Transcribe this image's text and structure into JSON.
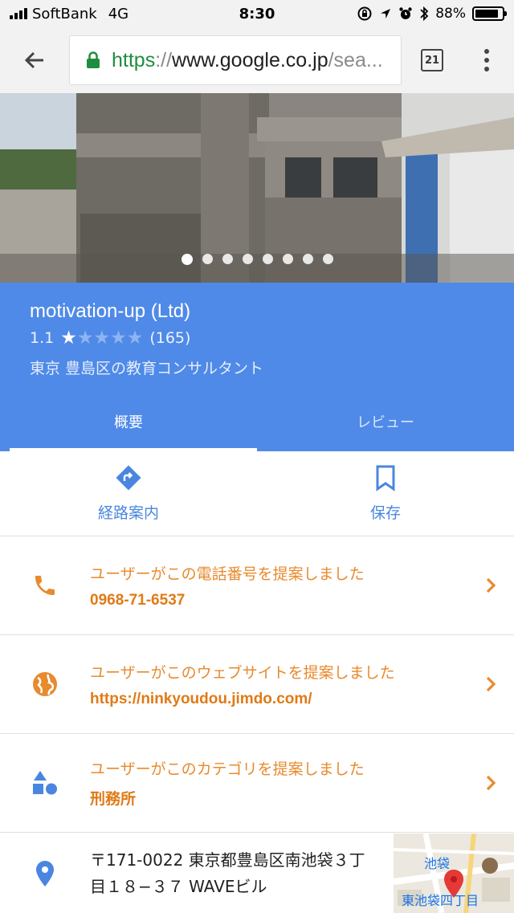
{
  "status_bar": {
    "carrier": "SoftBank",
    "network": "4G",
    "time": "8:30",
    "battery": "88%",
    "battery_level": 0.88
  },
  "browser": {
    "url_scheme": "https",
    "url_sep": "://",
    "url_host": "www.google.co.jp",
    "url_tail": "/sea...",
    "tab_count": "21"
  },
  "photo": {
    "page_count": 8,
    "active_index": 0
  },
  "place": {
    "name": "motivation-up (Ltd)",
    "rating": "1.1",
    "stars_filled": 1,
    "stars_total": 5,
    "review_count": "(165)",
    "category": "東京 豊島区の教育コンサルタント"
  },
  "tabs": [
    {
      "label": "概要",
      "active": true
    },
    {
      "label": "レビュー",
      "active": false
    }
  ],
  "actions": {
    "directions_label": "経路案内",
    "save_label": "保存"
  },
  "info": {
    "phone_suggest": "ユーザーがこの電話番号を提案しました",
    "phone": "0968-71-6537",
    "website_suggest": "ユーザーがこのウェブサイトを提案しました",
    "website": "https://ninkyoudou.jimdo.com/",
    "category_suggest": "ユーザーがこのカテゴリを提案しました",
    "category": "刑務所",
    "address_line1": "〒171-0022 東京都豊島区南池袋３丁",
    "address_line2": "目１８−３７ WAVEビル"
  },
  "map": {
    "label_station": "池袋",
    "label_area": "東池袋四丁目"
  },
  "colors": {
    "accent_blue": "#4f8ae8",
    "suggest_orange": "#e88a2e",
    "link_blue": "#4a86e0"
  }
}
